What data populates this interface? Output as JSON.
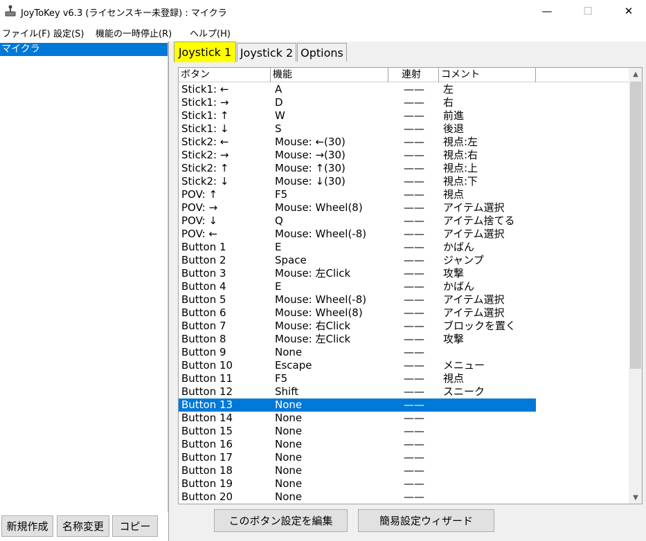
{
  "window": {
    "title": "JoyToKey v6.3 (ライセンスキー未登録) : マイクラ",
    "minimize": "—",
    "maximize": "☐",
    "close": "✕"
  },
  "menu": [
    "ファイル(F)",
    "設定(S)",
    "機能の一時停止(R)",
    "ヘルプ(H)"
  ],
  "configs": {
    "selected": "マイクラ"
  },
  "left_buttons": {
    "new": "新規作成",
    "rename": "名称変更",
    "copy": "コピー"
  },
  "tabs": [
    "Joystick 1",
    "Joystick 2",
    "Options"
  ],
  "columns": [
    "ボタン",
    "機能",
    "連射",
    "コメント"
  ],
  "rows": [
    {
      "button": "Stick1: ←",
      "function": "A",
      "rapid": "——",
      "comment": "左"
    },
    {
      "button": "Stick1: →",
      "function": "D",
      "rapid": "——",
      "comment": "右"
    },
    {
      "button": "Stick1: ↑",
      "function": "W",
      "rapid": "——",
      "comment": "前進"
    },
    {
      "button": "Stick1: ↓",
      "function": "S",
      "rapid": "——",
      "comment": "後退"
    },
    {
      "button": "Stick2: ←",
      "function": "Mouse: ←(30)",
      "rapid": "——",
      "comment": "視点:左"
    },
    {
      "button": "Stick2: →",
      "function": "Mouse: →(30)",
      "rapid": "——",
      "comment": "視点:右"
    },
    {
      "button": "Stick2: ↑",
      "function": "Mouse: ↑(30)",
      "rapid": "——",
      "comment": "視点:上"
    },
    {
      "button": "Stick2: ↓",
      "function": "Mouse: ↓(30)",
      "rapid": "——",
      "comment": "視点:下"
    },
    {
      "button": "POV: ↑",
      "function": "F5",
      "rapid": "——",
      "comment": "視点"
    },
    {
      "button": "POV: →",
      "function": "Mouse: Wheel(8)",
      "rapid": "——",
      "comment": "アイテム選択"
    },
    {
      "button": "POV: ↓",
      "function": "Q",
      "rapid": "——",
      "comment": "アイテム捨てる"
    },
    {
      "button": "POV: ←",
      "function": "Mouse: Wheel(-8)",
      "rapid": "——",
      "comment": "アイテム選択"
    },
    {
      "button": "Button 1",
      "function": "E",
      "rapid": "——",
      "comment": "かばん"
    },
    {
      "button": "Button 2",
      "function": "Space",
      "rapid": "——",
      "comment": "ジャンプ"
    },
    {
      "button": "Button 3",
      "function": "Mouse: 左Click",
      "rapid": "——",
      "comment": "攻撃"
    },
    {
      "button": "Button 4",
      "function": "E",
      "rapid": "——",
      "comment": "かばん"
    },
    {
      "button": "Button 5",
      "function": "Mouse: Wheel(-8)",
      "rapid": "——",
      "comment": "アイテム選択"
    },
    {
      "button": "Button 6",
      "function": "Mouse: Wheel(8)",
      "rapid": "——",
      "comment": "アイテム選択"
    },
    {
      "button": "Button 7",
      "function": "Mouse: 右Click",
      "rapid": "——",
      "comment": "ブロックを置く"
    },
    {
      "button": "Button 8",
      "function": "Mouse: 左Click",
      "rapid": "——",
      "comment": "攻撃"
    },
    {
      "button": "Button 9",
      "function": "None",
      "rapid": "——",
      "comment": ""
    },
    {
      "button": "Button 10",
      "function": "Escape",
      "rapid": "——",
      "comment": "メニュー"
    },
    {
      "button": "Button 11",
      "function": "F5",
      "rapid": "——",
      "comment": "視点"
    },
    {
      "button": "Button 12",
      "function": "Shift",
      "rapid": "——",
      "comment": "スニーク"
    },
    {
      "button": "Button 13",
      "function": "None",
      "rapid": "——",
      "comment": "",
      "selected": true
    },
    {
      "button": "Button 14",
      "function": "None",
      "rapid": "——",
      "comment": ""
    },
    {
      "button": "Button 15",
      "function": "None",
      "rapid": "——",
      "comment": ""
    },
    {
      "button": "Button 16",
      "function": "None",
      "rapid": "——",
      "comment": ""
    },
    {
      "button": "Button 17",
      "function": "None",
      "rapid": "——",
      "comment": ""
    },
    {
      "button": "Button 18",
      "function": "None",
      "rapid": "——",
      "comment": ""
    },
    {
      "button": "Button 19",
      "function": "None",
      "rapid": "——",
      "comment": ""
    },
    {
      "button": "Button 20",
      "function": "None",
      "rapid": "——",
      "comment": ""
    }
  ],
  "right_buttons": {
    "edit": "このボタン設定を編集",
    "wizard": "簡易設定ウィザード"
  },
  "colors": {
    "selection": "#0078d7",
    "active_tab": "#ffff00"
  },
  "icons": {
    "app": "joystick-icon",
    "scroll_up": "chevron-up-icon",
    "scroll_down": "chevron-down-icon"
  }
}
